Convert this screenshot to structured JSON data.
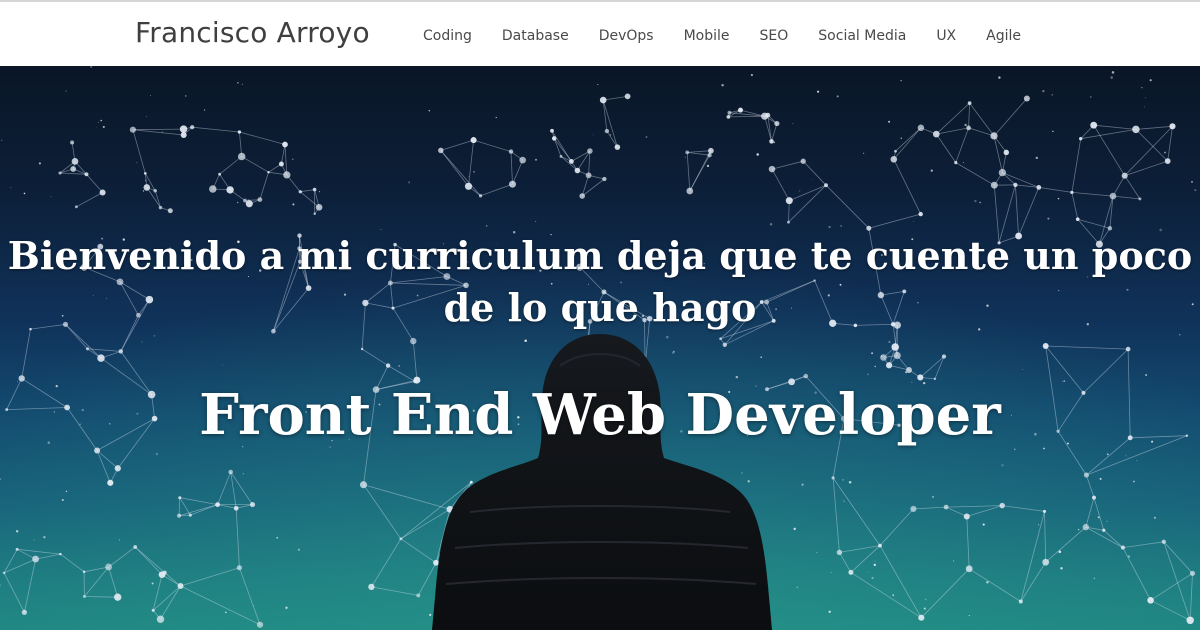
{
  "header": {
    "brand": "Francisco Arroyo",
    "nav": [
      {
        "label": "Coding"
      },
      {
        "label": "Database"
      },
      {
        "label": "DevOps"
      },
      {
        "label": "Mobile"
      },
      {
        "label": "SEO"
      },
      {
        "label": "Social Media"
      },
      {
        "label": "UX"
      },
      {
        "label": "Agile"
      }
    ]
  },
  "hero": {
    "headline": "Bienvenido a mi curriculum deja que te cuente un poco de lo que hago",
    "role": "Front End Web Developer",
    "background": "night sky with constellation network lines and a hooded person seen from behind",
    "colors": {
      "sky_top": "#0a1627",
      "sky_bottom": "#1f8582",
      "network": "#dfe8f3"
    }
  }
}
